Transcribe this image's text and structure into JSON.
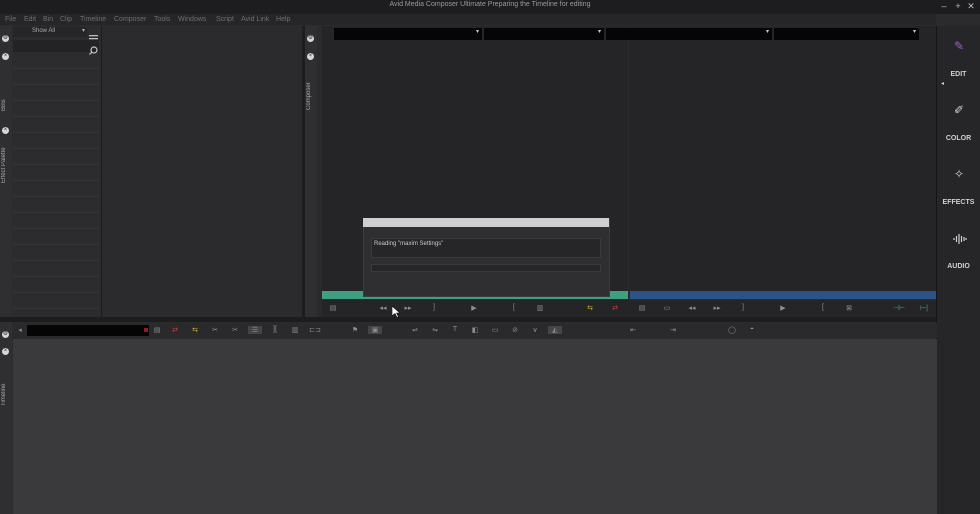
{
  "window": {
    "title": "Avid Media Composer Ultimate  Preparing the Timeline for editing",
    "minimize": "–",
    "maximize": "+",
    "close": "✕"
  },
  "menu": [
    "File",
    "Edit",
    "Bin",
    "Clip",
    "Timeline",
    "Composer",
    "Tools",
    "Windows",
    "Script",
    "Avid Link",
    "Help"
  ],
  "bins": {
    "tab_label": "Bins",
    "filter_value": "Show All",
    "filter_arrow": "▾"
  },
  "effect_palette": {
    "tab_label": "Effect Palette"
  },
  "composer": {
    "tab_label": "Composer"
  },
  "timeline": {
    "tab_label": "Timeline"
  },
  "dialog": {
    "message": "Reading \"maxim Settings\""
  },
  "dropdowns": [
    {
      "arrow": "▾"
    },
    {
      "arrow": "▾"
    },
    {
      "arrow": "▾"
    },
    {
      "arrow": "▾"
    }
  ],
  "workspaces": [
    {
      "label": "EDIT",
      "icon": "edit-workspace-icon",
      "color": "#a35bd6"
    },
    {
      "label": "COLOR",
      "icon": "color-brush-icon",
      "color": "#d0d0d0"
    },
    {
      "label": "EFFECTS",
      "icon": "effects-wand-icon",
      "color": "#d0d0d0"
    },
    {
      "label": "AUDIO",
      "icon": "audio-waveform-icon",
      "color": "#d0d0d0"
    }
  ],
  "colors": {
    "source_bar": "#3e9f82",
    "record_bar": "#2c5287",
    "accent": "#a35bd6"
  }
}
